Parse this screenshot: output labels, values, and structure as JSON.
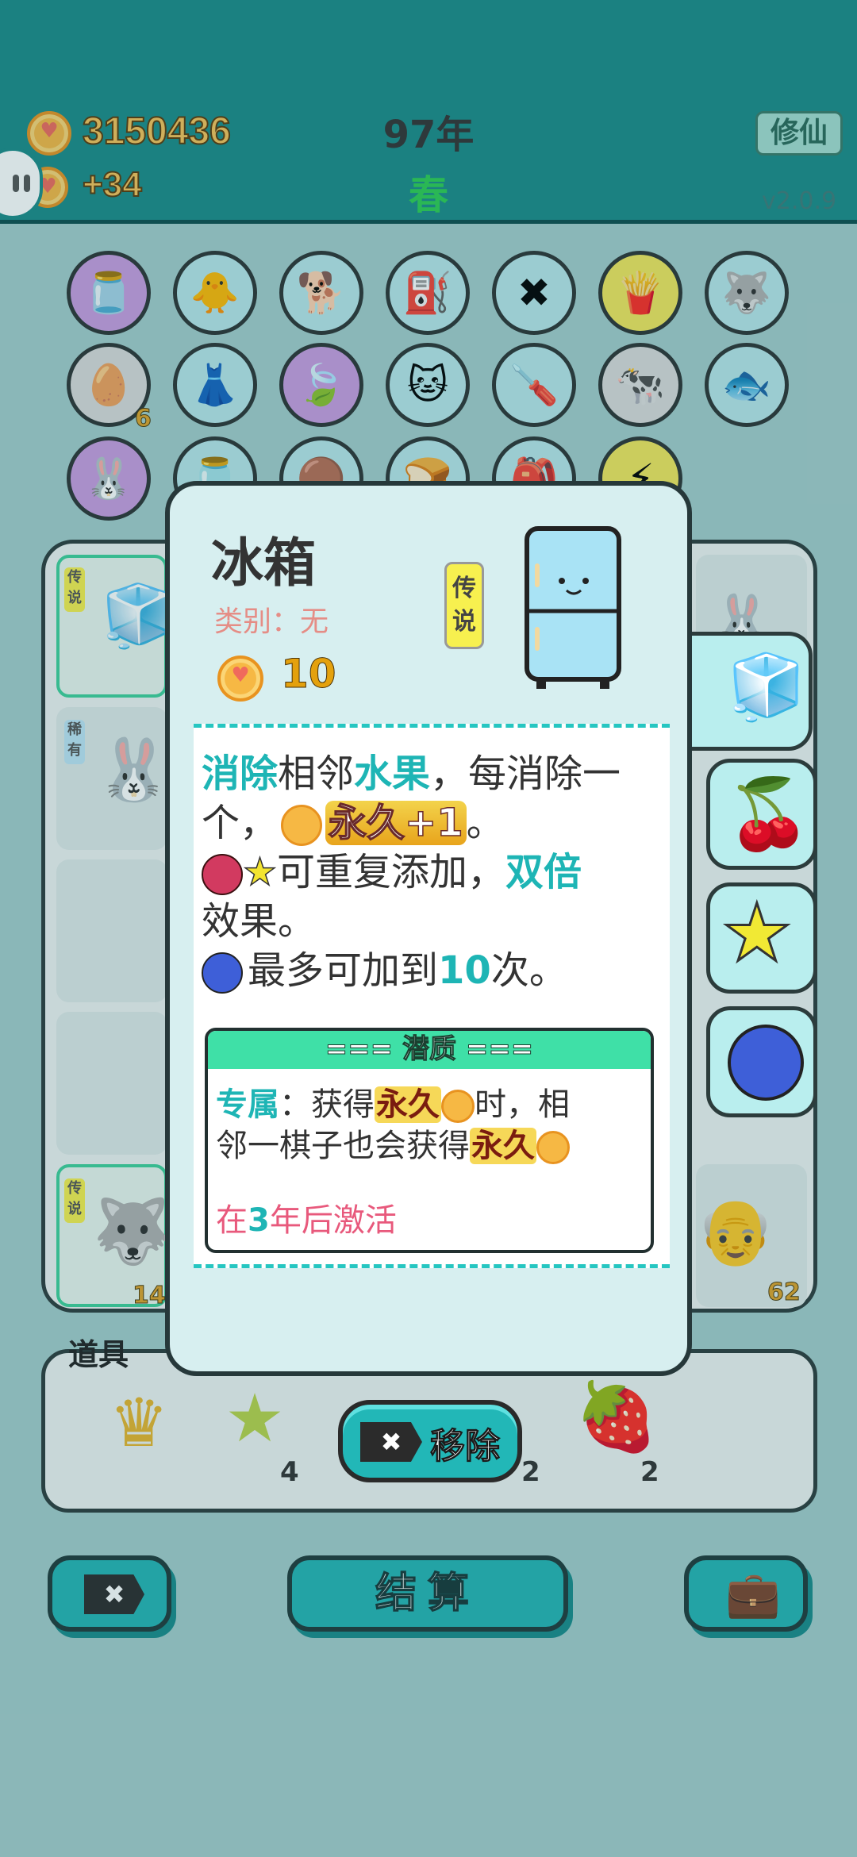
{
  "header": {
    "coins": "3150436",
    "income": "+34",
    "year": "97年",
    "season": "春",
    "cultivate_button": "修仙",
    "version": "v2.0.9"
  },
  "inventory_counts": [
    "6"
  ],
  "board": {
    "tags": [
      "传说",
      "稀有",
      "传说"
    ],
    "counts": [
      "14",
      "62"
    ]
  },
  "tools": {
    "label": "道具",
    "counts": [
      "4",
      "2",
      "2"
    ]
  },
  "remove_button": "移除",
  "settle_button": "结算",
  "modal": {
    "title": "冰箱",
    "category": "类别：无",
    "cost": "10",
    "rarity": "传说",
    "description": {
      "l1_a": "消除",
      "l1_b": "相邻",
      "l1_c": "水果",
      "l1_d": "，每消除一",
      "l2_a": "个，",
      "l2_b": "永久+1",
      "l2_c": "。",
      "l3_a": "可重复添加，",
      "l3_b": "双倍",
      "l4": "效果。",
      "l5_a": "最多可加到",
      "l5_b": "10",
      "l5_c": "次。"
    },
    "potential": {
      "header": "=== 潜质 ===",
      "exclusive": "专属",
      "t1_a": "：获得",
      "t1_b": "永久",
      "t1_c": "时，相",
      "t2_a": "邻一棋子也会获得",
      "t2_b": "永久",
      "activate_a": "在",
      "activate_b": "3",
      "activate_c": "年后激活"
    }
  },
  "colors": {
    "header": "#1b8a88",
    "accent_teal": "#1eb5b5",
    "coin": "#f6b844",
    "legend_tag": "#f7f04f",
    "potential_header": "#3fe0a7"
  }
}
